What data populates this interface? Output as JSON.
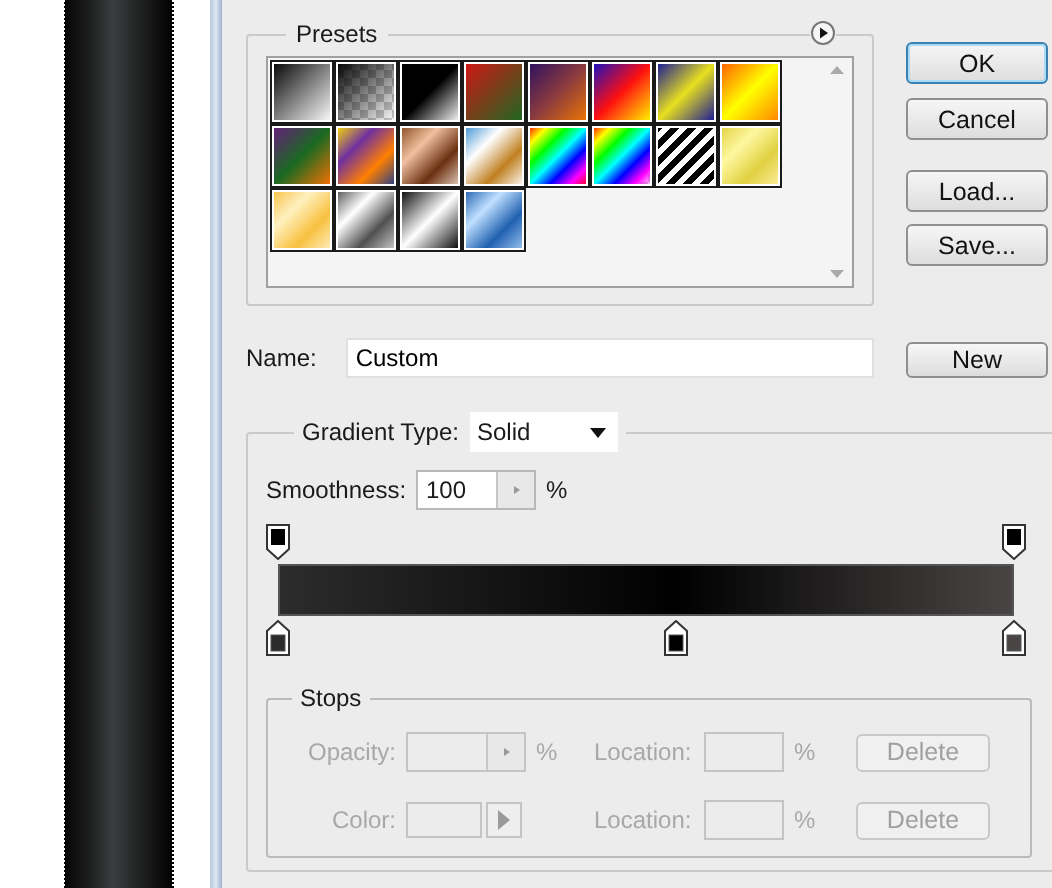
{
  "presets": {
    "title": "Presets"
  },
  "buttons": [
    {
      "label": "OK",
      "default": true
    },
    {
      "label": "Cancel",
      "default": false
    },
    {
      "label": "Load...",
      "default": false
    },
    {
      "label": "Save...",
      "default": false
    }
  ],
  "name": {
    "label": "Name:",
    "value": "Custom"
  },
  "new_button": "New",
  "gradient": {
    "type_label": "Gradient Type:",
    "type_value": "Solid",
    "smoothness_label": "Smoothness:",
    "smoothness_value": "100",
    "smoothness_unit": "%",
    "opacity_stops": [
      {
        "level": 0,
        "color": "#000000"
      },
      {
        "level": 1,
        "color": "#000000"
      }
    ],
    "color_stops": [
      {
        "level": 0,
        "color": "#2c2c2c"
      },
      {
        "level": 0.54,
        "color": "#000000"
      },
      {
        "level": 1,
        "color": "#4a4545"
      }
    ]
  },
  "stops": {
    "title": "Stops",
    "rows": [
      {
        "kind": "opacity",
        "label": "Opacity:",
        "unit": "%",
        "location_label": "Location:",
        "location_unit": "%",
        "delete": "Delete",
        "disabled": true
      },
      {
        "kind": "color",
        "label": "Color:",
        "location_label": "Location:",
        "location_unit": "%",
        "delete": "Delete",
        "disabled": true
      }
    ]
  }
}
